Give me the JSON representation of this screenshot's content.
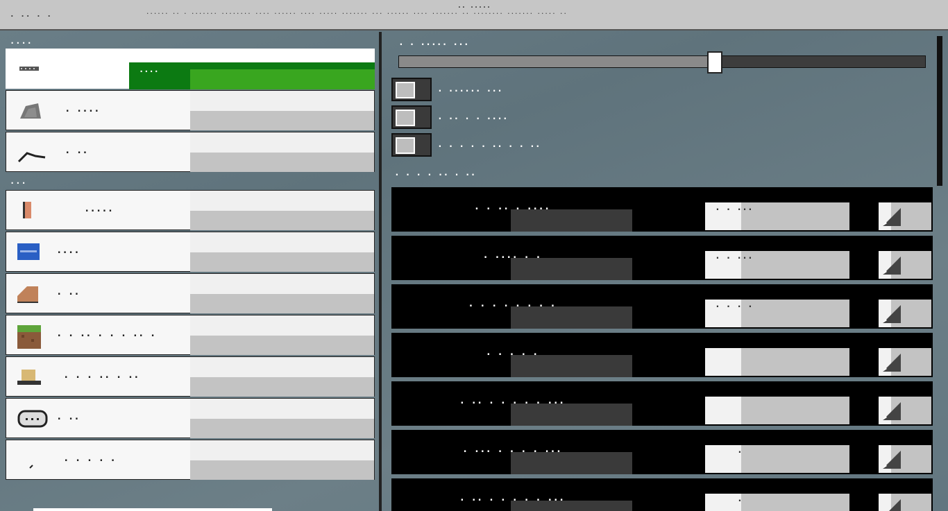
{
  "topbar": {
    "left": ". ..  . .",
    "title": ".. .....",
    "status": "...... .. . ....... ........ .... ...... .... ..... ....... ... ...... .... ....... .. ........ ....... ..... .."
  },
  "left_panel": {
    "group1_label": "....",
    "group2_label": "...",
    "items": [
      {
        "icon": "dotted-bar-icon",
        "label": "",
        "selected": true,
        "selected_label": "...."
      },
      {
        "icon": "stone-icon",
        "label": ". ...."
      },
      {
        "icon": "curve-icon",
        "label": ". .."
      },
      {
        "icon": "orange-block-icon",
        "label": "....."
      },
      {
        "icon": "blue-block-icon",
        "label": "...."
      },
      {
        "icon": "brown-stair-icon",
        "label": ". .."
      },
      {
        "icon": "grass-block-icon",
        "label": ". . .. . . . .. ."
      },
      {
        "icon": "hat-icon",
        "label": ". . . .. . .."
      },
      {
        "icon": "speech-bubble-icon",
        "label": ". .."
      },
      {
        "icon": "pencil-icon",
        "label": ". . . . ."
      }
    ]
  },
  "right_panel": {
    "slider_label": ". . ..... ...",
    "slider_value": 0.6,
    "checks": [
      {
        "label": ". ...... ...",
        "checked": false
      },
      {
        "label": ". .. . . ....",
        "checked": false
      },
      {
        "label": ". . . . . .. . . ..",
        "checked": false
      }
    ],
    "section_label": ". . . . .. . ..",
    "rows": [
      {
        "label": ". . .. . ....",
        "value": ". . ..."
      },
      {
        "label": ". .... . .",
        "value": ". . ..."
      },
      {
        "label": ". . . . . . . .",
        "value": ". . . ."
      },
      {
        "label": ". . . . .",
        "value": ""
      },
      {
        "label": ". .. . . . . . ...",
        "value": ""
      },
      {
        "label": ". ... . . . . ...",
        "value": "."
      },
      {
        "label": ". .. . . . . . ...",
        "value": "."
      }
    ]
  },
  "colors": {
    "selected_dark": "#0c7a12",
    "selected_light": "#39a61f",
    "background": "#6b7f88"
  }
}
